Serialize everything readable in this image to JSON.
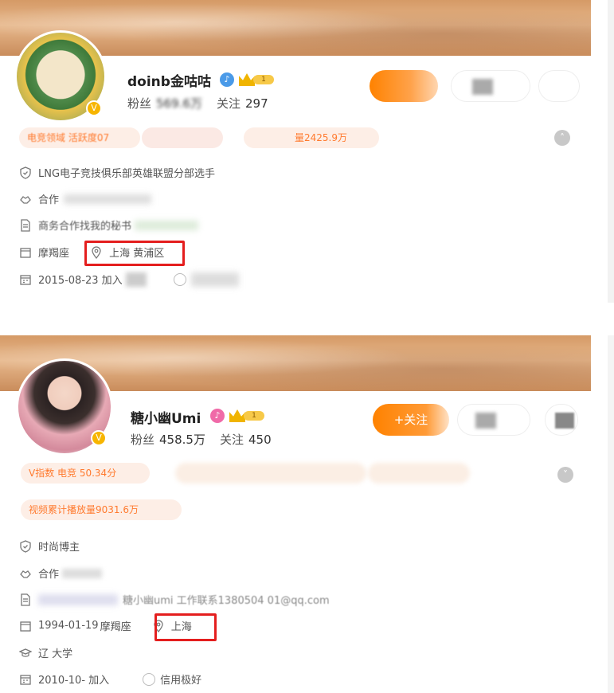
{
  "profile1": {
    "name": "doinb金咕咕",
    "fans_label": "粉丝",
    "fans_value": "569.6万",
    "follow_label": "关注",
    "follow_value": "297",
    "tags": [
      "电竞领域 活跃度07",
      "",
      "量2425.9万"
    ],
    "info": {
      "bio": "LNG电子竞技俱乐部英雄联盟分部选手",
      "cooperation": "合作",
      "business": "商务合作找我的秘书",
      "zodiac": "摩羯座",
      "location": "上海 黄浦区",
      "joined": "2015-08-23 加入"
    },
    "level_badge": "1"
  },
  "profile2": {
    "name": "糖小幽Umi",
    "fans_label": "粉丝",
    "fans_value": "458.5万",
    "follow_label": "关注",
    "follow_value": "450",
    "follow_button": "+关注",
    "tags": [
      "V指数 电竞 50.34分",
      "视频累计播放量9031.6万"
    ],
    "info": {
      "bio": "时尚博主",
      "cooperation": "合作",
      "email": "糖小幽umi 工作联系1380504 01@qq.com",
      "birthday": "1994-01-19",
      "zodiac": "摩羯座",
      "location": "上海",
      "school": "辽 大学",
      "joined": "2010-10- 加入",
      "credit": "信用极好"
    },
    "level_badge": "1"
  },
  "colors": {
    "accent": "#ff8200",
    "tag_text": "#ff7a2e",
    "highlight_box": "#e41e1e"
  },
  "icons": [
    "shield-icon",
    "handshake-icon",
    "document-icon",
    "calendar-icon",
    "location-pin-icon",
    "graduation-icon",
    "verified-icon",
    "crown-icon"
  ]
}
